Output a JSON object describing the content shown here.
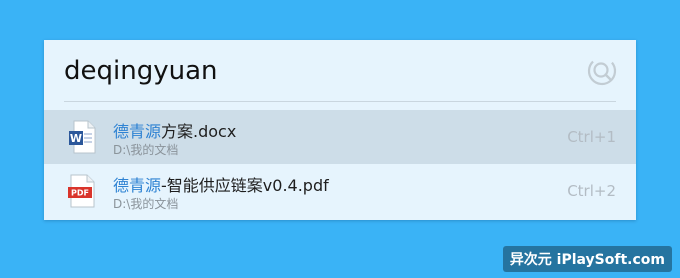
{
  "search": {
    "query": "deqingyuan",
    "icon": "search-loop-icon"
  },
  "results": [
    {
      "name_highlight": "德青源",
      "name_rest": "方案.docx",
      "path": "D:\\我的文档",
      "shortcut": "Ctrl+1",
      "icon": "word-doc-icon",
      "selected": true
    },
    {
      "name_highlight": "德青源",
      "name_rest": "-智能供应链案v0.4.pdf",
      "path": "D:\\我的文档",
      "shortcut": "Ctrl+2",
      "icon": "pdf-icon",
      "icon_label": "PDF",
      "selected": false
    }
  ],
  "watermark": "异次元 iPlaySoft.com",
  "colors": {
    "background": "#3ab3f6",
    "panel": "#e6f4fd",
    "selected_row": "#cddde8",
    "highlight": "#2f83d3",
    "word_blue": "#2b579a",
    "pdf_red": "#d9342b"
  }
}
